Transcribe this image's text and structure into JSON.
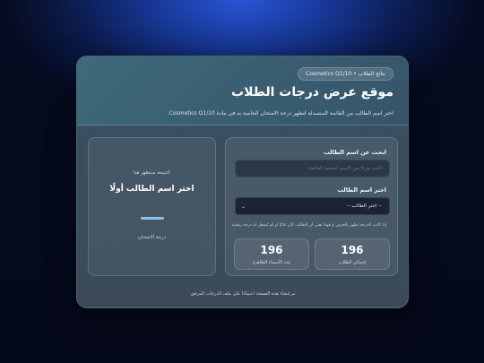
{
  "header": {
    "badge": "نتائج الطلاب • Cosmetics Q1/10",
    "title": "موقع عرض درجات الطلاب",
    "subtitle": "اختر اسم الطالب من القائمة المنسدلة لتظهر درجة الامتحان الخاصة به في مادة Cosmetics Q1/10."
  },
  "search": {
    "label": "ابحث عن اسم الطالب",
    "placeholder": "اكتب جزءًا من الاسم لتصفية القائمة"
  },
  "select": {
    "label": "اختر اسم الطالب",
    "selected": "-- اختر الطالب --"
  },
  "note": "إذا كانت الدرجة تظهر بالحرف غ فهذا يعني أن الطالب كان غائبًا أو لم تُسجل له درجة رقمية.",
  "stats": {
    "total_students": {
      "value": "196",
      "label": "إجمالي الطلاب"
    },
    "shown_names": {
      "value": "196",
      "label": "عدد الأسماء الظاهرة"
    }
  },
  "result": {
    "top": "النتيجة ستظهر هنا",
    "main": "اختر اسم الطالب أولًا",
    "caption": "درجة الامتحان"
  },
  "footer": "تم إنشاء هذه الصفحة اعتمادًا على ملف الدرجات المرفق.",
  "colors": {
    "accent": "#8ec4ea",
    "background": "#060c22",
    "glow": "#2a55d8"
  }
}
